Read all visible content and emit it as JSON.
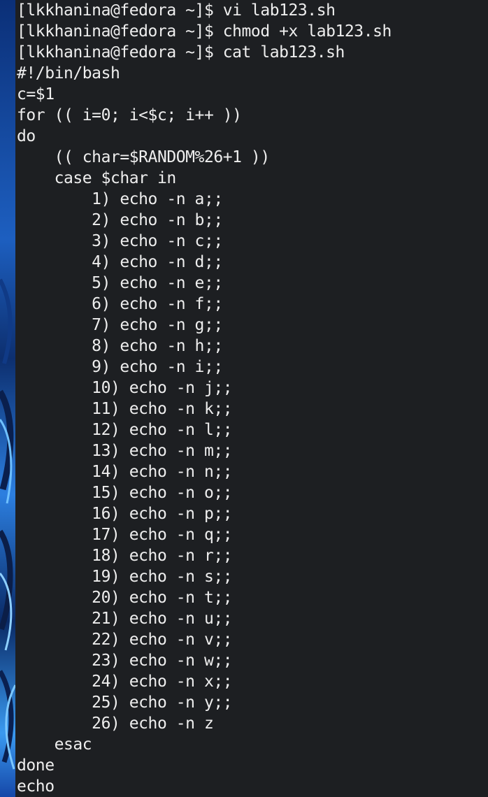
{
  "terminal": {
    "lines": [
      "[lkkhanina@fedora ~]$ vi lab123.sh",
      "[lkkhanina@fedora ~]$ chmod +x lab123.sh",
      "[lkkhanina@fedora ~]$ cat lab123.sh",
      "#!/bin/bash",
      "c=$1",
      "for (( i=0; i<$c; i++ ))",
      "do",
      "    (( char=$RANDOM%26+1 ))",
      "    case $char in",
      "        1) echo -n a;;",
      "        2) echo -n b;;",
      "        3) echo -n c;;",
      "        4) echo -n d;;",
      "        5) echo -n e;;",
      "        6) echo -n f;;",
      "        7) echo -n g;;",
      "        8) echo -n h;;",
      "        9) echo -n i;;",
      "        10) echo -n j;;",
      "        11) echo -n k;;",
      "        12) echo -n l;;",
      "        13) echo -n m;;",
      "        14) echo -n n;;",
      "        15) echo -n o;;",
      "        16) echo -n p;;",
      "        17) echo -n q;;",
      "        18) echo -n r;;",
      "        19) echo -n s;;",
      "        20) echo -n t;;",
      "        21) echo -n u;;",
      "        22) echo -n v;;",
      "        23) echo -n w;;",
      "        24) echo -n x;;",
      "        25) echo -n y;;",
      "        26) echo -n z",
      "    esac",
      "done",
      "echo"
    ]
  }
}
